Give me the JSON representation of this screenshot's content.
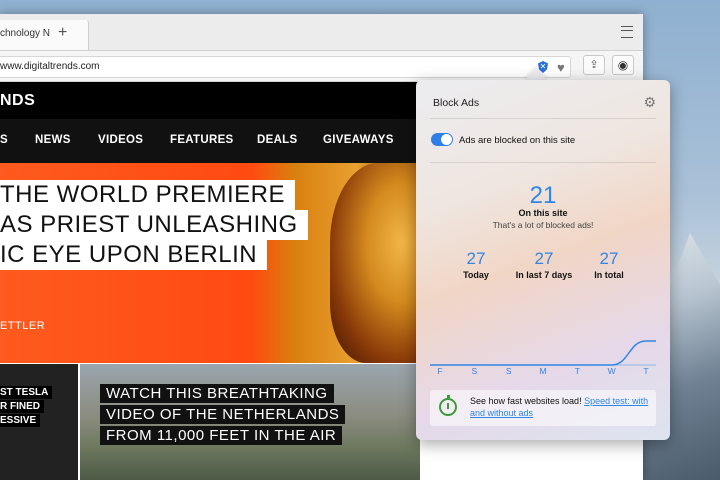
{
  "browser": {
    "tab_title": "chnology N",
    "url": "www.digitaltrends.com"
  },
  "site": {
    "logo": "NDS",
    "nav": [
      "S",
      "NEWS",
      "VIDEOS",
      "FEATURES",
      "DEALS",
      "GIVEAWAYS"
    ],
    "hero_lines": [
      "THE WORLD PREMIERE",
      "AS PRIEST UNLEASHING",
      "IC EYE UPON BERLIN"
    ],
    "author": "ETTLER",
    "card_left_lines": [
      "ST TESLA",
      "R FINED",
      "ESSIVE"
    ],
    "card_right_lines": [
      "WATCH THIS BREATHTAKING",
      "VIDEO OF THE NETHERLANDS",
      "FROM 11,000 FEET IN THE AIR"
    ]
  },
  "popover": {
    "title": "Block Ads",
    "toggle_label": "Ads are blocked on this site",
    "toggle_on": true,
    "site_count": "21",
    "site_label": "On this site",
    "site_note": "That's a lot of blocked ads!",
    "stats": [
      {
        "value": "27",
        "label": "Today"
      },
      {
        "value": "27",
        "label": "In last 7 days"
      },
      {
        "value": "27",
        "label": "In total"
      }
    ],
    "days": [
      "F",
      "S",
      "S",
      "M",
      "T",
      "W",
      "T"
    ],
    "daily_values": [
      0,
      0,
      0,
      0,
      0,
      0,
      27
    ],
    "speed_text": "See how fast websites load!",
    "speed_link": "Speed test: with and without ads",
    "accent_color": "#2f86e6"
  }
}
